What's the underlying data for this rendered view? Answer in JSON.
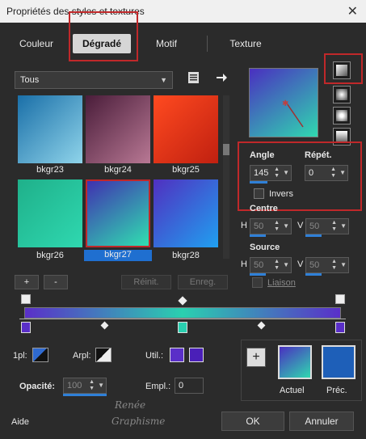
{
  "window": {
    "title": "Propriétés des styles et textures",
    "close_glyph": "✕"
  },
  "tabs": [
    {
      "label": "Couleur",
      "active": false
    },
    {
      "label": "Dégradé",
      "active": true
    },
    {
      "label": "Motif",
      "active": false
    },
    {
      "label": "Texture",
      "active": false
    }
  ],
  "category": {
    "selected": "Tous"
  },
  "gradients": [
    {
      "name": "bkgr23",
      "colors": [
        "#1a6fa8",
        "#8fd4ea"
      ]
    },
    {
      "name": "bkgr24",
      "colors": [
        "#4a1d3a",
        "#b87894"
      ]
    },
    {
      "name": "bkgr25",
      "colors": [
        "#c02010",
        "#ff4a20"
      ]
    },
    {
      "name": "bkgr26",
      "colors": [
        "#1fb08a",
        "#2fd8b0"
      ]
    },
    {
      "name": "bkgr27",
      "colors": [
        "#4030b0",
        "#30e0b0"
      ],
      "selected": true
    },
    {
      "name": "bkgr28",
      "colors": [
        "#5030c0",
        "#20a0f0"
      ]
    }
  ],
  "settings": {
    "angle_label": "Angle",
    "angle_value": "145",
    "repeat_label": "Répét.",
    "repeat_value": "0",
    "invert_label": "Invers",
    "centre_label": "Centre",
    "centre_h_label": "H",
    "centre_h_value": "50",
    "centre_v_label": "V",
    "centre_v_value": "50",
    "source_label": "Source",
    "source_h_label": "H",
    "source_h_value": "50",
    "source_v_label": "V",
    "source_v_value": "50",
    "link_label": "Liaison"
  },
  "buttons": {
    "add": "+",
    "remove": "-",
    "reset": "Réinit.",
    "save": "Enreg."
  },
  "editor": {
    "one_pl_label": "1pl:",
    "arpl_label": "Arpl:",
    "util_label": "Util.:",
    "opacity_label": "Opacité:",
    "opacity_value": "100",
    "empl_label": "Empl.:",
    "empl_value": "0",
    "start_color": "#5a2fc8",
    "mid_color": "#2ad0b0",
    "end_color": "#5a2fc8"
  },
  "preview": {
    "current_label": "Actuel",
    "previous_label": "Préc.",
    "plus_glyph": "+",
    "previous_color": "#1e5fb8"
  },
  "watermark": {
    "line1": "Renée",
    "line2": "Graphisme"
  },
  "footer": {
    "help": "Aide",
    "ok": "OK",
    "cancel": "Annuler"
  }
}
